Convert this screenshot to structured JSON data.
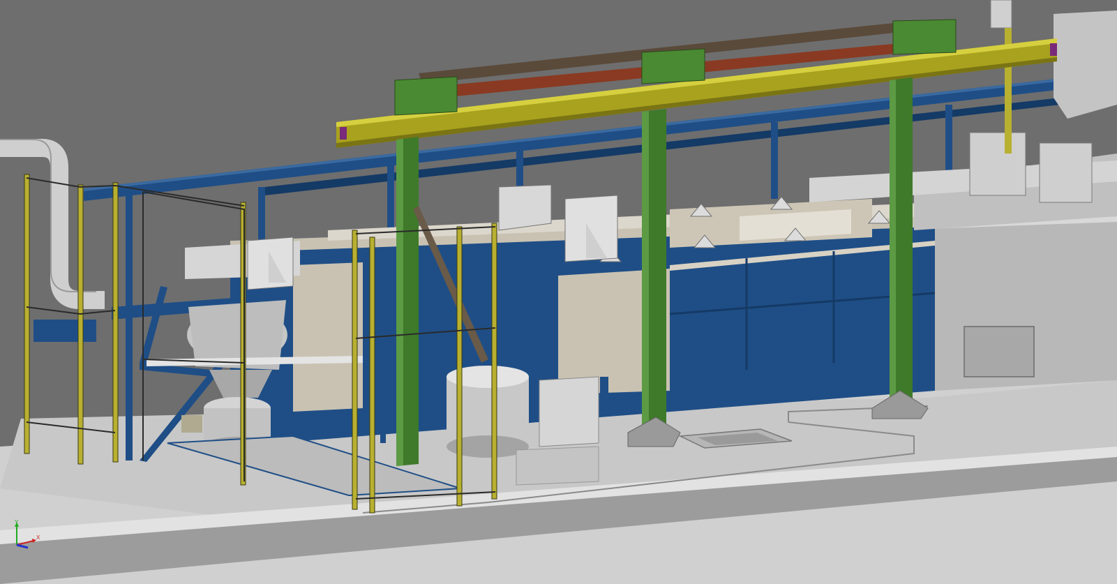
{
  "viewport": {
    "background_color": "#6e6e6e"
  },
  "scene": {
    "colors": {
      "floor": "#d2d2d2",
      "slab_top": "#c4c4c4",
      "slab_front": "#9a9a9a",
      "blue_frame": "#1f4e86",
      "blue_dark": "#143a66",
      "green_column": "#3e7a2a",
      "yellow_beam": "#a8a21e",
      "yellow_guard": "#b8b030",
      "rail_brown": "#5a4a3a",
      "rail_red": "#8a3a22",
      "tank_beige": "#c9c2b2",
      "tank_grey": "#bdbdbd",
      "cabinet_grey": "#b8b8b8",
      "duct_grey": "#cfcfcf"
    }
  },
  "triad": {
    "y_label": "Y",
    "x_label": "X",
    "y_color": "#22aa22",
    "x_color": "#cc2222",
    "z_color": "#2233cc"
  }
}
